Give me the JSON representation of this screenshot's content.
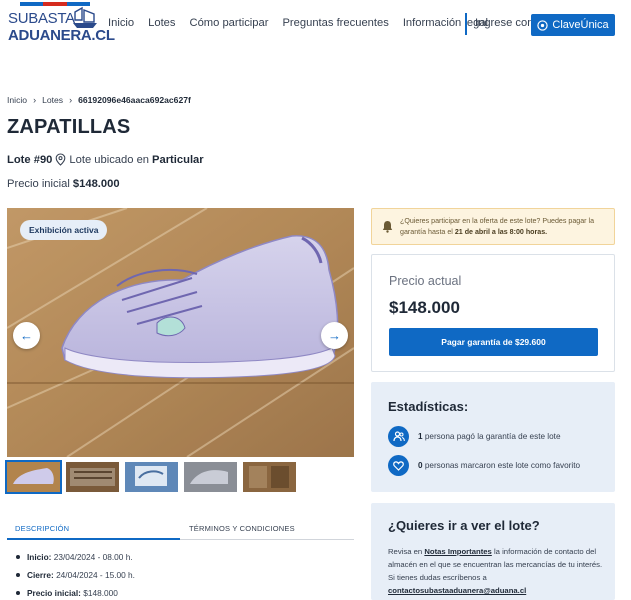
{
  "header": {
    "logo_line1": "SUBASTA",
    "logo_line2": "ADUANERA.CL",
    "nav": [
      "Inicio",
      "Lotes",
      "Cómo participar",
      "Preguntas frecuentes",
      "Información legal"
    ],
    "login_prompt": "Ingrese con",
    "login_button": "ClaveÚnica"
  },
  "breadcrumb": {
    "home": "Inicio",
    "lotes": "Lotes",
    "current": "66192096e46aaca692ac627f"
  },
  "product": {
    "title": "ZAPATILLAS",
    "lote": "Lote #90",
    "location_prefix": "Lote ubicado en",
    "location": "Particular",
    "initial_price_label": "Precio inicial",
    "initial_price": "$148.000",
    "badge": "Exhibición activa"
  },
  "tabs": {
    "description": "DESCRIPCIÓN",
    "terms": "TÉRMINOS Y CONDICIONES"
  },
  "description_items": [
    {
      "label": "Inicio:",
      "value": "23/04/2024 - 08.00 h."
    },
    {
      "label": "Cierre:",
      "value": "24/04/2024 - 15.00 h."
    },
    {
      "label": "Precio inicial:",
      "value": "$148.000"
    }
  ],
  "alert": {
    "text": "¿Quieres participar en la oferta de este lote? Puedes pagar la garantía hasta el",
    "deadline": "21 de abril a las 8:00 horas."
  },
  "price_card": {
    "label": "Precio actual",
    "value": "$148.000",
    "button": "Pagar garantía de $29.600"
  },
  "stats": {
    "title": "Estadísticas:",
    "paid_count": "1",
    "paid_text": "persona pagó la garantía de este lote",
    "fav_count": "0",
    "fav_text": "personas marcaron este lote como favorito"
  },
  "visit": {
    "title": "¿Quieres ir a ver el lote?",
    "text_before": "Revisa en",
    "link": "Notas Importantes",
    "text_after": "la información de contacto del almacén en el que se encuentran las mercancías de tu interés. Si tienes dudas escríbenos a",
    "email": "contactosubastaaduanera@aduana.cl"
  },
  "colors": {
    "primary": "#0f69c4",
    "panel": "#e7eef7",
    "alert_bg": "#fdf4e0"
  }
}
